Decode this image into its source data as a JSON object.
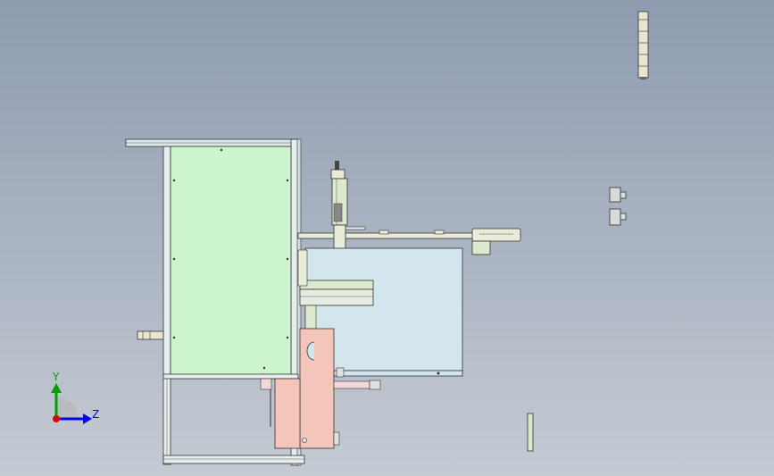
{
  "view": {
    "background_top": "#8e9bb0",
    "background_bottom": "#c5cbd3"
  },
  "triad": {
    "y_label": "Y",
    "z_label": "Z",
    "y_color": "#00a000",
    "z_color": "#0000ff",
    "origin_color": "#e00000"
  },
  "part_colors": {
    "frame_panel": "#cdf5cd",
    "box": "#d3e6ee",
    "plate": "#f4c6bb",
    "frame_line": "#3a3a3a",
    "bar": "#dbe9cf"
  }
}
